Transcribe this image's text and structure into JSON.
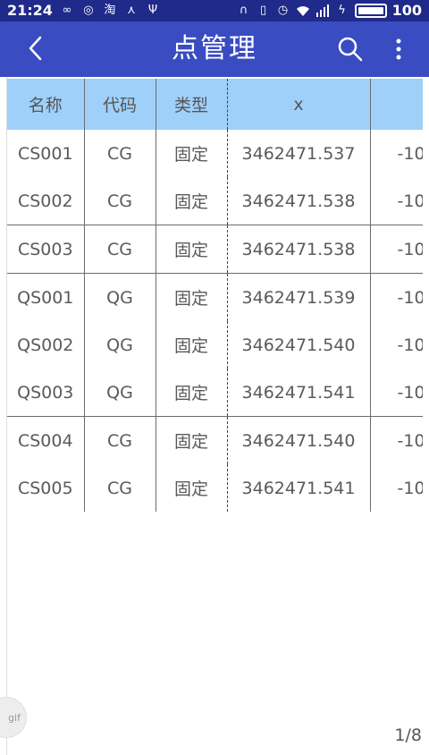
{
  "status_bar": {
    "time": "21:24",
    "battery_level": "100",
    "icons": [
      "infinity-icon",
      "weibo-icon",
      "taobao-icon",
      "network-icon",
      "usb-icon",
      "headphone-icon",
      "vibrate-icon",
      "alarm-icon",
      "wifi-icon",
      "signal-icon",
      "charging-icon",
      "battery-icon"
    ]
  },
  "app_bar": {
    "title": "点管理",
    "back_icon": "back-chevron-icon",
    "search_icon": "search-icon",
    "more_icon": "more-vert-icon"
  },
  "table": {
    "headers": [
      "名称",
      "代码",
      "类型",
      "x",
      ""
    ],
    "rows": [
      {
        "name": "CS001",
        "code": "CG",
        "type": "固定",
        "x": "3462471.537",
        "y": "-10"
      },
      {
        "name": "CS002",
        "code": "CG",
        "type": "固定",
        "x": "3462471.538",
        "y": "-10"
      },
      {
        "name": "CS003",
        "code": "CG",
        "type": "固定",
        "x": "3462471.538",
        "y": "-10"
      },
      {
        "name": "QS001",
        "code": "QG",
        "type": "固定",
        "x": "3462471.539",
        "y": "-10"
      },
      {
        "name": "QS002",
        "code": "QG",
        "type": "固定",
        "x": "3462471.540",
        "y": "-10"
      },
      {
        "name": "QS003",
        "code": "QG",
        "type": "固定",
        "x": "3462471.541",
        "y": "-10"
      },
      {
        "name": "CS004",
        "code": "CG",
        "type": "固定",
        "x": "3462471.540",
        "y": "-10"
      },
      {
        "name": "CS005",
        "code": "CG",
        "type": "固定",
        "x": "3462471.541",
        "y": "-10"
      }
    ]
  },
  "overlay": {
    "gif_label": "gif",
    "page_indicator": "1/8"
  },
  "colors": {
    "status_bar": "#1f2a8a",
    "app_bar": "#3a4cc1",
    "header_row": "#9ed0fa"
  }
}
